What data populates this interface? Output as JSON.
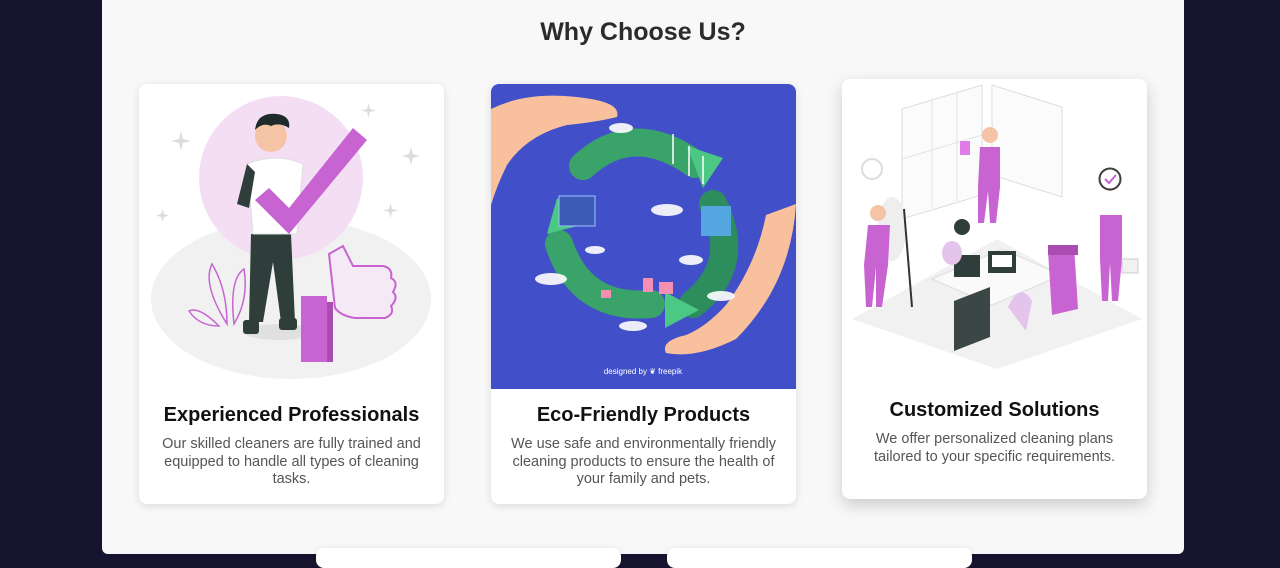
{
  "section": {
    "title": "Why Choose Us?"
  },
  "cards": [
    {
      "title": "Experienced Professionals",
      "description": "Our skilled cleaners are fully trained and equipped to handle all types of cleaning tasks.",
      "image_icon": "professional-thumbs-up-illustration"
    },
    {
      "title": "Eco-Friendly Products",
      "description": "We use safe and environmentally friendly cleaning products to ensure the health of your family and pets.",
      "image_icon": "recycle-earth-hands-illustration",
      "image_credit": "designed by ❦ freepik"
    },
    {
      "title": "Customized Solutions",
      "description": "We offer personalized cleaning plans tailored to your specific requirements.",
      "image_icon": "office-cleaning-team-illustration"
    }
  ],
  "colors": {
    "background": "#17142f",
    "panel": "#f8f8f8",
    "accent": "#c864d2",
    "eco_blue": "#4150c8"
  }
}
